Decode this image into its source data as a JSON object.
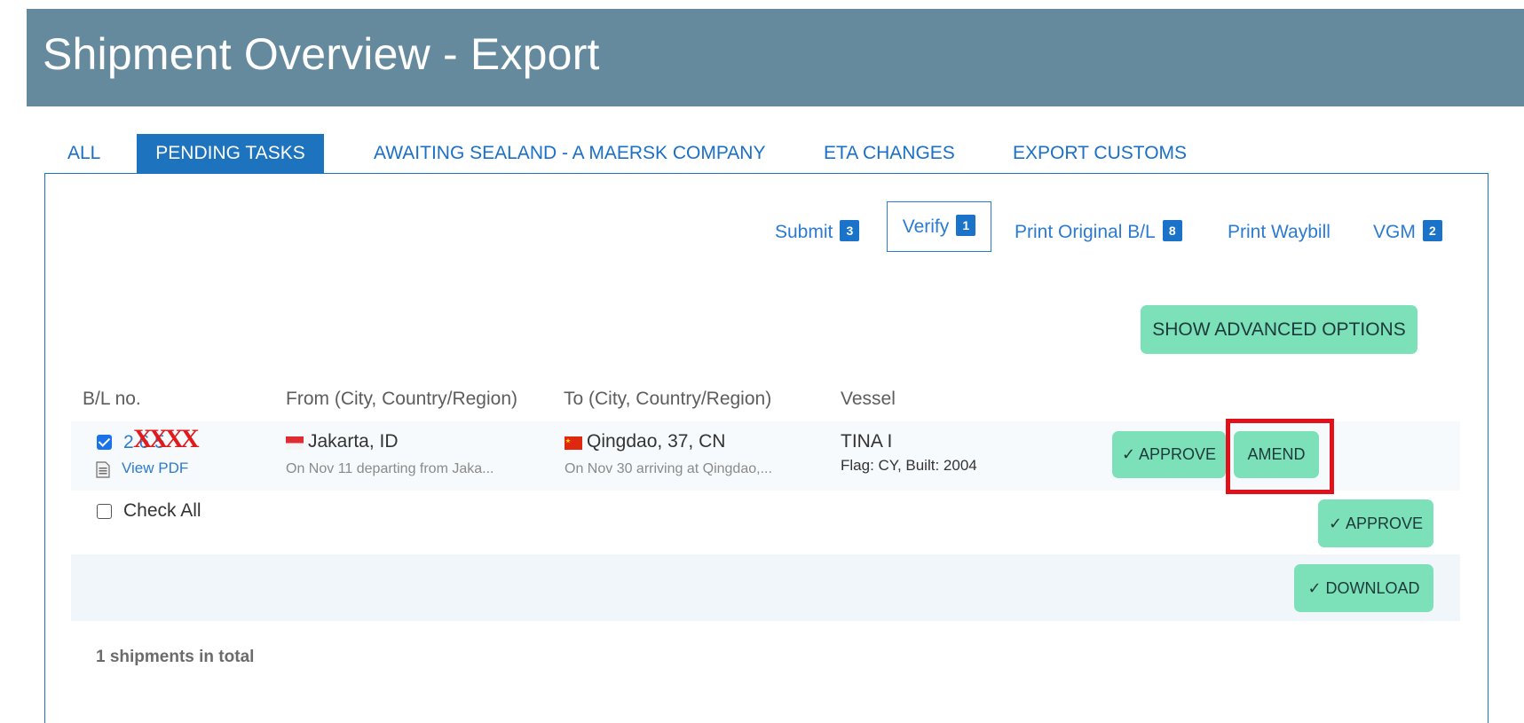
{
  "header": {
    "title": "Shipment Overview - Export"
  },
  "tabs": [
    {
      "label": "ALL"
    },
    {
      "label": "PENDING TASKS",
      "active": true
    },
    {
      "label": "AWAITING SEALAND - A MAERSK COMPANY"
    },
    {
      "label": "ETA CHANGES"
    },
    {
      "label": "EXPORT CUSTOMS"
    }
  ],
  "subtabs": [
    {
      "label": "Submit",
      "count": "3"
    },
    {
      "label": "Verify",
      "count": "1",
      "active": true
    },
    {
      "label": "Print Original B/L",
      "count": "8"
    },
    {
      "label": "Print Waybill"
    },
    {
      "label": "VGM",
      "count": "2"
    }
  ],
  "advanced_button": "SHOW ADVANCED OPTIONS",
  "columns": {
    "bl": "B/L no.",
    "from": "From (City, Country/Region)",
    "to": "To (City, Country/Region)",
    "vessel": "Vessel"
  },
  "shipment": {
    "checked": true,
    "bl_number": "2 6 5",
    "redaction_mark": "XXXX",
    "view_pdf": "View PDF",
    "from_city": "Jakarta, ID",
    "from_detail": "On Nov 11 departing from Jaka...",
    "to_city": "Qingdao, 37, CN",
    "to_detail": "On Nov 30 arriving at Qingdao,...",
    "vessel_name": "TINA I",
    "vessel_detail": "Flag: CY, Built: 2004",
    "approve_label": "✓ APPROVE",
    "amend_label": "AMEND"
  },
  "check_all": {
    "label": "Check All",
    "checked": false
  },
  "approve_all_label": "✓ APPROVE",
  "download_label": "✓ DOWNLOAD",
  "total_text": "1 shipments in total",
  "colors": {
    "header_bg": "#658a9e",
    "accent_blue": "#1e73be",
    "button_green": "#7ce0b8",
    "highlight_red": "#e0111a"
  }
}
